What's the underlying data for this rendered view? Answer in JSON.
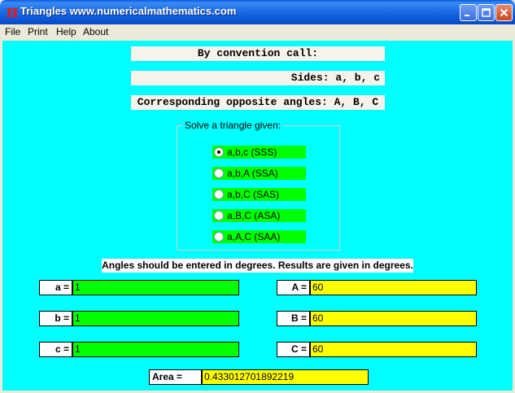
{
  "window": {
    "icon_glyph": "π",
    "title": "Triangles  www.numericalmathematics.com"
  },
  "menu": {
    "file": "File",
    "print": "Print",
    "help": "Help",
    "about": "About"
  },
  "notes": {
    "convention": "By convention call:",
    "sides": "Sides: a, b, c",
    "angles": "Corresponding opposite angles: A, B, C",
    "degrees": "Angles should be entered in degrees. Results are given in degrees."
  },
  "solve_group": {
    "legend": "Solve a triangle given:",
    "options": [
      {
        "label": "a,b,c (SSS)",
        "checked": true
      },
      {
        "label": "a,b,A (SSA)",
        "checked": false
      },
      {
        "label": "a,b,C (SAS)",
        "checked": false
      },
      {
        "label": "a,B,C (ASA)",
        "checked": false
      },
      {
        "label": "a,A,C (SAA)",
        "checked": false
      }
    ]
  },
  "fields": {
    "a": {
      "label": "a =",
      "value": "1"
    },
    "b": {
      "label": "b =",
      "value": "1"
    },
    "c": {
      "label": "c =",
      "value": "1"
    },
    "A": {
      "label": "A =",
      "value": "60"
    },
    "B": {
      "label": "B =",
      "value": "60"
    },
    "C": {
      "label": "C =",
      "value": "60"
    },
    "area": {
      "label": "Area =",
      "value": "0.433012701892219"
    }
  },
  "colors": {
    "client_background": "#00ffff",
    "input_side": "#00ff00",
    "input_angle": "#ffff00",
    "radio_background": "#00ff00"
  }
}
